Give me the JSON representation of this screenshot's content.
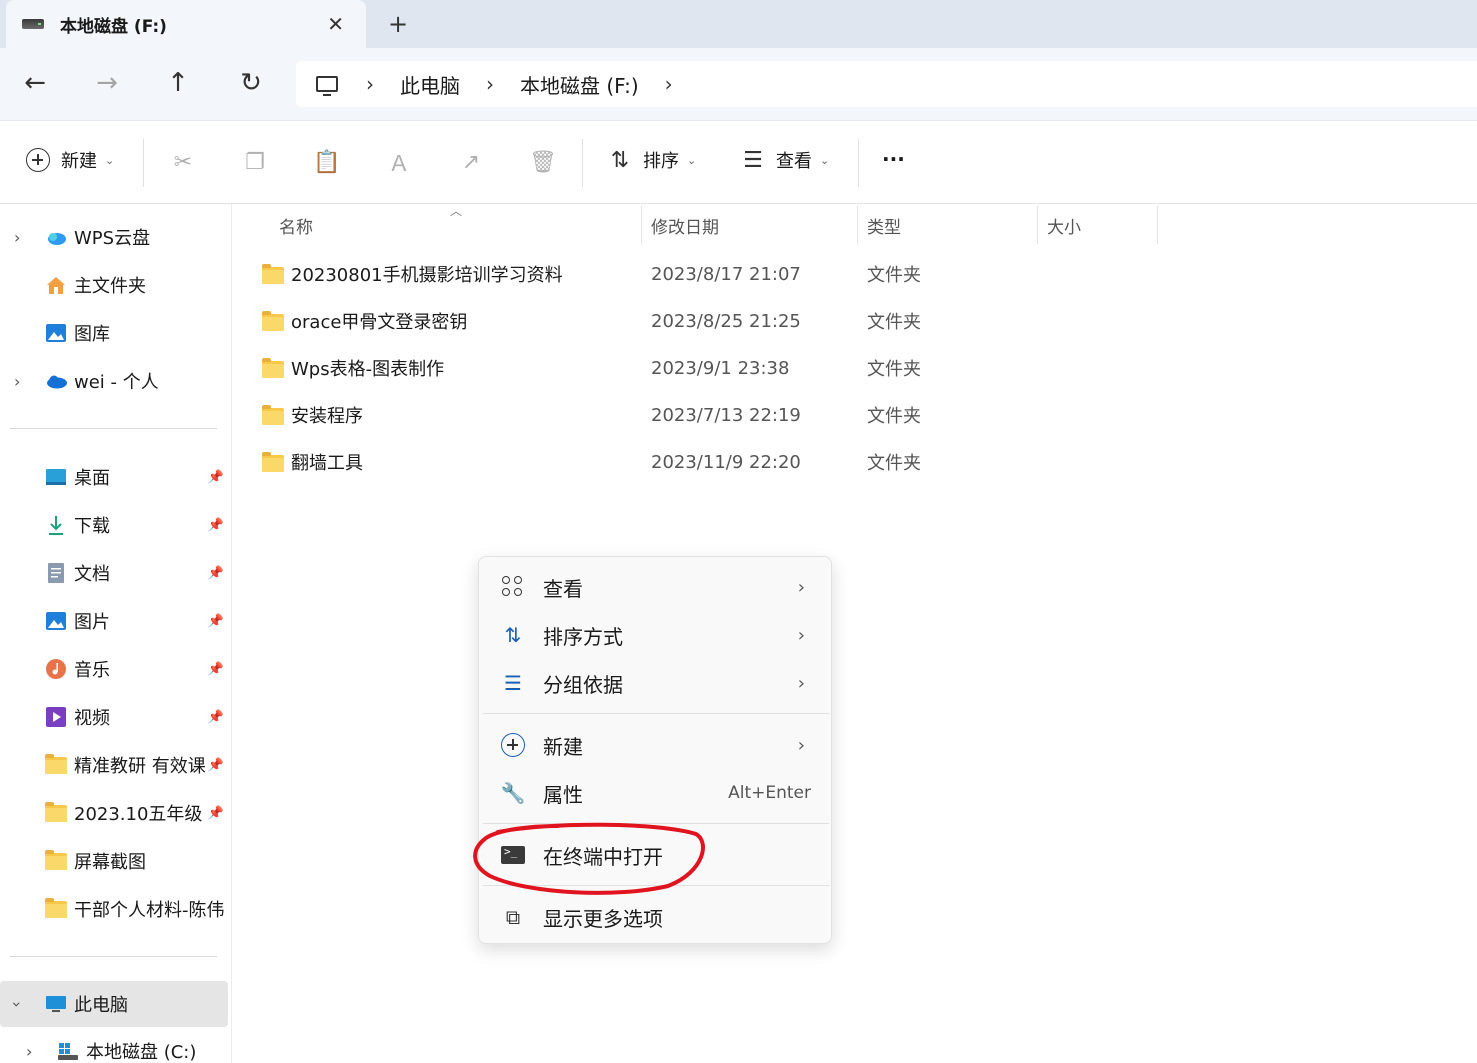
{
  "window": {
    "tab_title": "本地磁盘 (F:)",
    "tab_close": "✕",
    "new_tab": "+"
  },
  "nav": {
    "back": "←",
    "forward": "→",
    "up": "↑",
    "refresh": "↻",
    "breadcrumbs": [
      "此电脑",
      "本地磁盘 (F:)"
    ],
    "sep": "›"
  },
  "toolbar": {
    "new_label": "新建",
    "sort_label": "排序",
    "view_label": "查看",
    "more_label": "···",
    "chevron": "⌄"
  },
  "sidebar": {
    "top_items": [
      {
        "label": "WPS云盘",
        "icon": "cloud-icon",
        "expandable": true
      },
      {
        "label": "主文件夹",
        "icon": "home-icon",
        "expandable": false
      },
      {
        "label": "图库",
        "icon": "gallery-icon",
        "expandable": false
      },
      {
        "label": "wei - 个人",
        "icon": "onedrive-icon",
        "expandable": true
      }
    ],
    "quick_items": [
      {
        "label": "桌面",
        "icon": "desktop-icon"
      },
      {
        "label": "下载",
        "icon": "download-icon"
      },
      {
        "label": "文档",
        "icon": "document-icon"
      },
      {
        "label": "图片",
        "icon": "pictures-icon"
      },
      {
        "label": "音乐",
        "icon": "music-icon"
      },
      {
        "label": "视频",
        "icon": "video-icon"
      },
      {
        "label": "精准教研 有效课",
        "icon": "folder-icon"
      },
      {
        "label": "2023.10五年级",
        "icon": "folder-icon"
      },
      {
        "label": "屏幕截图",
        "icon": "folder-icon"
      },
      {
        "label": "干部个人材料-陈伟",
        "icon": "folder-icon"
      }
    ],
    "this_pc": "此电脑",
    "local_c": "本地磁盘 (C:)"
  },
  "columns": {
    "name": "名称",
    "date": "修改日期",
    "type": "类型",
    "size": "大小"
  },
  "files": [
    {
      "name": "20230801手机摄影培训学习资料",
      "date": "2023/8/17 21:07",
      "type": "文件夹"
    },
    {
      "name": "orace甲骨文登录密钥",
      "date": "2023/8/25 21:25",
      "type": "文件夹"
    },
    {
      "name": "Wps表格-图表制作",
      "date": "2023/9/1 23:38",
      "type": "文件夹"
    },
    {
      "name": "安装程序",
      "date": "2023/7/13 22:19",
      "type": "文件夹"
    },
    {
      "name": "翻墙工具",
      "date": "2023/11/9 22:20",
      "type": "文件夹"
    }
  ],
  "context_menu": {
    "view": "查看",
    "sort": "排序方式",
    "group": "分组依据",
    "new": "新建",
    "properties": "属性",
    "properties_shortcut": "Alt+Enter",
    "open_terminal": "在终端中打开",
    "more_options": "显示更多选项",
    "arrow": "›"
  },
  "colors": {
    "accent": "#0067c0",
    "annotation": "#e0141e",
    "folder": "#f7c948"
  }
}
